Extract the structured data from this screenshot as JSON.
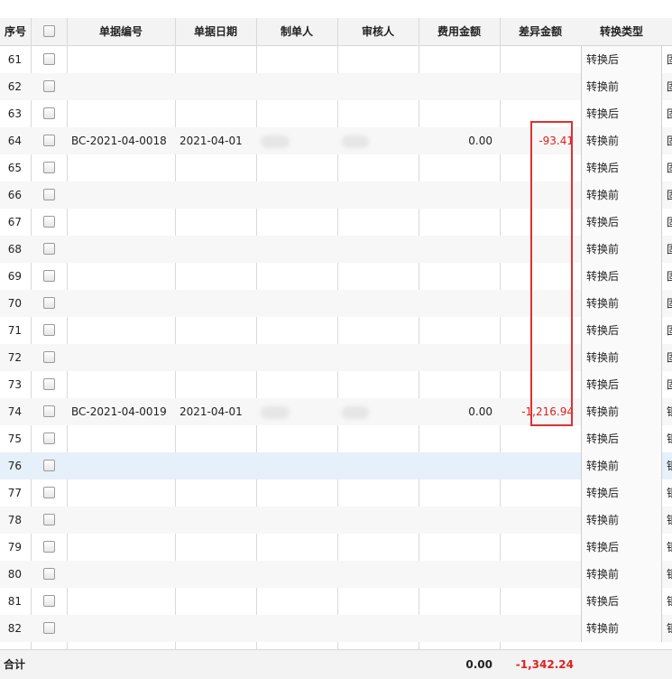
{
  "headers": {
    "seq": "序号",
    "doc_no": "单据编号",
    "doc_date": "单据日期",
    "maker": "制单人",
    "reviewer": "审核人",
    "fee_amount": "费用金额",
    "diff_amount": "差异金额",
    "conv_type": "转换类型"
  },
  "rows": [
    {
      "seq": "61",
      "doc_no": "",
      "doc_date": "",
      "fee": "",
      "diff": "",
      "conv": "转换后",
      "trunc": "固"
    },
    {
      "seq": "62",
      "doc_no": "",
      "doc_date": "",
      "fee": "",
      "diff": "",
      "conv": "转换前",
      "trunc": "固"
    },
    {
      "seq": "63",
      "doc_no": "",
      "doc_date": "",
      "fee": "",
      "diff": "",
      "conv": "转换后",
      "trunc": "固"
    },
    {
      "seq": "64",
      "doc_no": "BC-2021-04-0018",
      "doc_date": "2021-04-01",
      "fee": "0.00",
      "diff": "-93.41",
      "conv": "转换前",
      "trunc": "固"
    },
    {
      "seq": "65",
      "doc_no": "",
      "doc_date": "",
      "fee": "",
      "diff": "",
      "conv": "转换后",
      "trunc": "固"
    },
    {
      "seq": "66",
      "doc_no": "",
      "doc_date": "",
      "fee": "",
      "diff": "",
      "conv": "转换前",
      "trunc": "固"
    },
    {
      "seq": "67",
      "doc_no": "",
      "doc_date": "",
      "fee": "",
      "diff": "",
      "conv": "转换后",
      "trunc": "固"
    },
    {
      "seq": "68",
      "doc_no": "",
      "doc_date": "",
      "fee": "",
      "diff": "",
      "conv": "转换前",
      "trunc": "固"
    },
    {
      "seq": "69",
      "doc_no": "",
      "doc_date": "",
      "fee": "",
      "diff": "",
      "conv": "转换后",
      "trunc": "固"
    },
    {
      "seq": "70",
      "doc_no": "",
      "doc_date": "",
      "fee": "",
      "diff": "",
      "conv": "转换前",
      "trunc": "固"
    },
    {
      "seq": "71",
      "doc_no": "",
      "doc_date": "",
      "fee": "",
      "diff": "",
      "conv": "转换后",
      "trunc": "固"
    },
    {
      "seq": "72",
      "doc_no": "",
      "doc_date": "",
      "fee": "",
      "diff": "",
      "conv": "转换前",
      "trunc": "固"
    },
    {
      "seq": "73",
      "doc_no": "",
      "doc_date": "",
      "fee": "",
      "diff": "",
      "conv": "转换后",
      "trunc": "固"
    },
    {
      "seq": "74",
      "doc_no": "BC-2021-04-0019",
      "doc_date": "2021-04-01",
      "fee": "0.00",
      "diff": "-1,216.94",
      "conv": "转换前",
      "trunc": "银"
    },
    {
      "seq": "75",
      "doc_no": "",
      "doc_date": "",
      "fee": "",
      "diff": "",
      "conv": "转换后",
      "trunc": "银"
    },
    {
      "seq": "76",
      "doc_no": "",
      "doc_date": "",
      "fee": "",
      "diff": "",
      "conv": "转换前",
      "trunc": "银"
    },
    {
      "seq": "77",
      "doc_no": "",
      "doc_date": "",
      "fee": "",
      "diff": "",
      "conv": "转换后",
      "trunc": "银"
    },
    {
      "seq": "78",
      "doc_no": "",
      "doc_date": "",
      "fee": "",
      "diff": "",
      "conv": "转换前",
      "trunc": "银"
    },
    {
      "seq": "79",
      "doc_no": "",
      "doc_date": "",
      "fee": "",
      "diff": "",
      "conv": "转换后",
      "trunc": "银"
    },
    {
      "seq": "80",
      "doc_no": "",
      "doc_date": "",
      "fee": "",
      "diff": "",
      "conv": "转换前",
      "trunc": "银"
    },
    {
      "seq": "81",
      "doc_no": "",
      "doc_date": "",
      "fee": "",
      "diff": "",
      "conv": "转换后",
      "trunc": "银"
    },
    {
      "seq": "82",
      "doc_no": "",
      "doc_date": "",
      "fee": "",
      "diff": "",
      "conv": "转换前",
      "trunc": "银"
    }
  ],
  "footer": {
    "label": "合计",
    "fee_total": "0.00",
    "diff_total": "-1,342.24"
  },
  "colors": {
    "negative": "#e02020",
    "highlight_box": "#e03030",
    "selected_row": "#e6f0fb"
  }
}
